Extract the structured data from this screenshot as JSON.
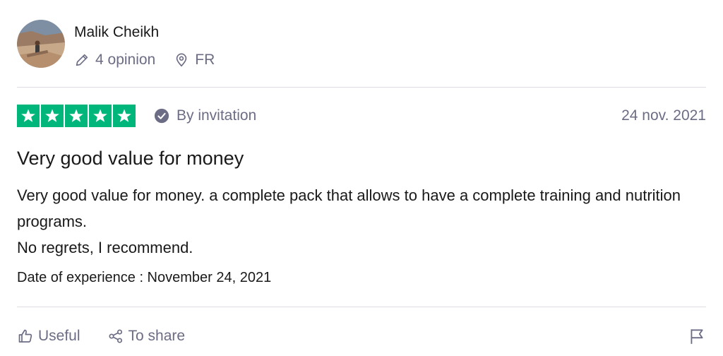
{
  "reviewer": {
    "name": "Malik Cheikh",
    "opinions": "4 opinion",
    "country": "FR"
  },
  "review": {
    "rating": 5,
    "rating_max": 5,
    "verification": "By invitation",
    "date": "24 nov. 2021",
    "title": "Very good value for money",
    "body_lines": [
      "Very good value for money. a complete pack that allows to have a complete training and nutrition programs.",
      "No regrets, I recommend."
    ],
    "experience": "Date of experience : November 24, 2021"
  },
  "actions": {
    "useful_label": "Useful",
    "share_label": "To share"
  },
  "colors": {
    "star_green": "#00b67a",
    "muted_text": "#6c6c85",
    "divider": "#dcdce6"
  },
  "icons": {
    "opinion": "pencil-icon",
    "country": "location-pin-icon",
    "verified": "check-circle-icon",
    "useful": "thumbs-up-icon",
    "share": "share-icon",
    "report": "flag-icon"
  }
}
